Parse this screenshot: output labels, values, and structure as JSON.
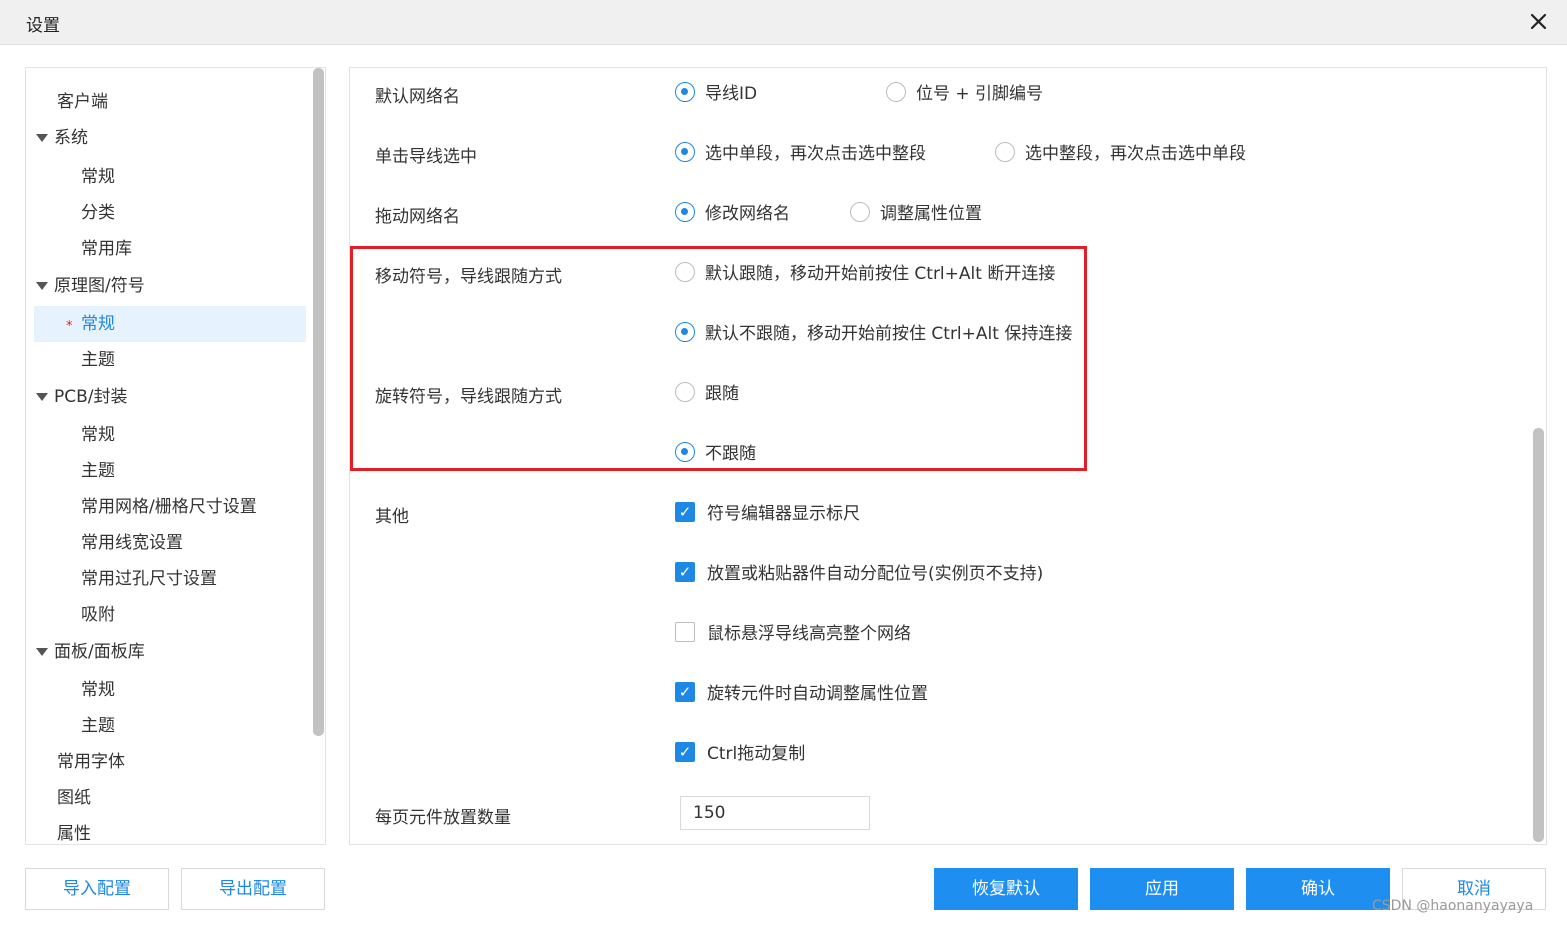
{
  "window": {
    "title": "设置",
    "close_icon": "close-icon"
  },
  "nav": {
    "items": [
      {
        "label": "客户端"
      },
      {
        "label": "系统"
      },
      {
        "label": "常规"
      },
      {
        "label": "分类"
      },
      {
        "label": "常用库"
      },
      {
        "label": "原理图/符号"
      },
      {
        "label": "常规",
        "modified_marker": "*",
        "selected": true
      },
      {
        "label": "主题"
      },
      {
        "label": "PCB/封装"
      },
      {
        "label": "常规"
      },
      {
        "label": "主题"
      },
      {
        "label": "常用网格/栅格尺寸设置"
      },
      {
        "label": "常用线宽设置"
      },
      {
        "label": "常用过孔尺寸设置"
      },
      {
        "label": "吸附"
      },
      {
        "label": "面板/面板库"
      },
      {
        "label": "常规"
      },
      {
        "label": "主题"
      },
      {
        "label": "常用字体"
      },
      {
        "label": "图纸"
      },
      {
        "label": "属性"
      }
    ]
  },
  "settings": {
    "default_net_name": {
      "label": "默认网络名",
      "options": [
        {
          "label": "导线ID",
          "selected": true
        },
        {
          "label": "位号 + 引脚编号",
          "selected": false
        }
      ]
    },
    "click_wire_select": {
      "label": "单击导线选中",
      "options": [
        {
          "label": "选中单段，再次点击选中整段",
          "selected": true
        },
        {
          "label": "选中整段，再次点击选中单段",
          "selected": false
        }
      ]
    },
    "drag_net_name": {
      "label": "拖动网络名",
      "options": [
        {
          "label": "修改网络名",
          "selected": true
        },
        {
          "label": "调整属性位置",
          "selected": false
        }
      ]
    },
    "move_symbol_wire_follow": {
      "label": "移动符号，导线跟随方式",
      "options": [
        {
          "label": "默认跟随，移动开始前按住 Ctrl+Alt 断开连接",
          "selected": false
        },
        {
          "label": "默认不跟随，移动开始前按住 Ctrl+Alt 保持连接",
          "selected": true
        }
      ]
    },
    "rotate_symbol_wire_follow": {
      "label": "旋转符号，导线跟随方式",
      "options": [
        {
          "label": "跟随",
          "selected": false
        },
        {
          "label": "不跟随",
          "selected": true
        }
      ]
    },
    "other": {
      "label": "其他",
      "checkboxes": [
        {
          "label": "符号编辑器显示标尺",
          "checked": true
        },
        {
          "label": "放置或粘贴器件自动分配位号(实例页不支持)",
          "checked": true
        },
        {
          "label": "鼠标悬浮导线高亮整个网络",
          "checked": false
        },
        {
          "label": "旋转元件时自动调整属性位置",
          "checked": true
        },
        {
          "label": "Ctrl拖动复制",
          "checked": true
        }
      ]
    },
    "parts_per_page": {
      "label": "每页元件放置数量",
      "value": "150"
    }
  },
  "footer": {
    "import_label": "导入配置",
    "export_label": "导出配置",
    "restore_label": "恢复默认",
    "apply_label": "应用",
    "confirm_label": "确认",
    "cancel_label": "取消"
  },
  "watermark": "CSDN @haonanyayaya",
  "colors": {
    "accent": "#1e88e5",
    "highlight_border": "#e11f26",
    "selected_bg": "#e6f2fd"
  }
}
